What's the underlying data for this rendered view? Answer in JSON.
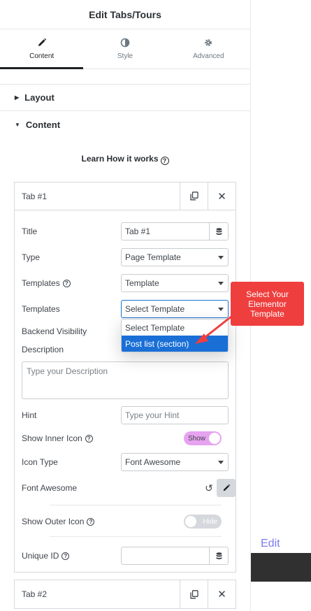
{
  "header": {
    "title": "Edit Tabs/Tours"
  },
  "tabs": [
    {
      "label": "Content",
      "icon": "pencil-icon",
      "active": true
    },
    {
      "label": "Style",
      "icon": "contrast-icon",
      "active": false
    },
    {
      "label": "Advanced",
      "icon": "gear-icon",
      "active": false
    }
  ],
  "sections": {
    "layout": "Layout",
    "content": "Content"
  },
  "learn": {
    "text": "Learn How it works"
  },
  "repeater": {
    "item1": {
      "title": "Tab #1",
      "fields": {
        "title_label": "Title",
        "title_value": "Tab #1",
        "type_label": "Type",
        "type_value": "Page Template",
        "templates_label": "Templates",
        "templates_value": "Template",
        "templates2_label": "Templates",
        "templates2_value": "Select Template",
        "backend_label": "Backend Visibility",
        "description_label": "Description",
        "description_placeholder": "Type your Description",
        "hint_label": "Hint",
        "hint_placeholder": "Type your Hint",
        "inner_icon_label": "Show Inner Icon",
        "inner_icon_toggle": "Show",
        "icon_type_label": "Icon Type",
        "icon_type_value": "Font Awesome",
        "font_awesome_label": "Font Awesome",
        "outer_icon_label": "Show Outer Icon",
        "outer_icon_toggle": "Hide",
        "unique_id_label": "Unique ID"
      }
    },
    "item2": {
      "title": "Tab #2"
    }
  },
  "dropdown": {
    "options": [
      "Select Template",
      "Post list (section)"
    ],
    "highlighted": "Post list (section)"
  },
  "callout": {
    "text": "Select Your Elementor Template",
    "color": "#ef3e3e"
  },
  "preview": {
    "edit_link": "Edit"
  },
  "colors": {
    "accent": "#1a6fd6",
    "toggle_on": "#e7a3f0"
  }
}
